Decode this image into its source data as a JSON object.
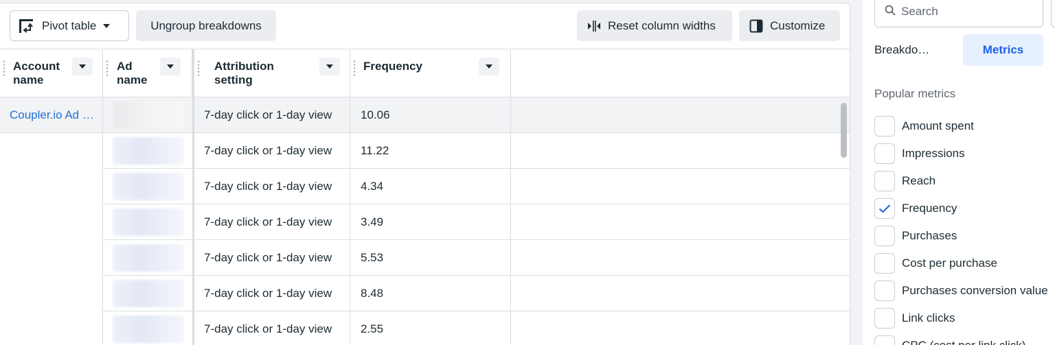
{
  "toolbar": {
    "pivot_label": "Pivot table",
    "ungroup_label": "Ungroup breakdowns",
    "reset_label": "Reset column widths",
    "customize_label": "Customize"
  },
  "table": {
    "columns": [
      {
        "line1": "Account",
        "line2": "name"
      },
      {
        "line1": "Ad",
        "line2": "name"
      },
      {
        "line1": "Attribution",
        "line2": "setting"
      },
      {
        "line1": "Frequency",
        "line2": ""
      }
    ],
    "account_name": "Coupler.io Ad …",
    "rows": [
      {
        "attribution": "7-day click or 1-day view",
        "frequency": "10.06"
      },
      {
        "attribution": "7-day click or 1-day view",
        "frequency": "11.22"
      },
      {
        "attribution": "7-day click or 1-day view",
        "frequency": "4.34"
      },
      {
        "attribution": "7-day click or 1-day view",
        "frequency": "3.49"
      },
      {
        "attribution": "7-day click or 1-day view",
        "frequency": "5.53"
      },
      {
        "attribution": "7-day click or 1-day view",
        "frequency": "8.48"
      },
      {
        "attribution": "7-day click or 1-day view",
        "frequency": "2.55"
      }
    ]
  },
  "side": {
    "search_placeholder": "Search",
    "tabs": [
      {
        "label": "Breakdo…",
        "active": false
      },
      {
        "label": "Metrics",
        "active": true
      }
    ],
    "section_title": "Popular metrics",
    "metrics": [
      {
        "label": "Amount spent",
        "checked": false
      },
      {
        "label": "Impressions",
        "checked": false
      },
      {
        "label": "Reach",
        "checked": false
      },
      {
        "label": "Frequency",
        "checked": true
      },
      {
        "label": "Purchases",
        "checked": false
      },
      {
        "label": "Cost per purchase",
        "checked": false
      },
      {
        "label": "Purchases conversion value",
        "checked": false
      },
      {
        "label": "Link clicks",
        "checked": false
      },
      {
        "label": "CPC (cost per link click)",
        "checked": false
      }
    ]
  },
  "colors": {
    "accent": "#1a62e6",
    "link": "#216fdb",
    "checkmark": "#1a62e6"
  }
}
